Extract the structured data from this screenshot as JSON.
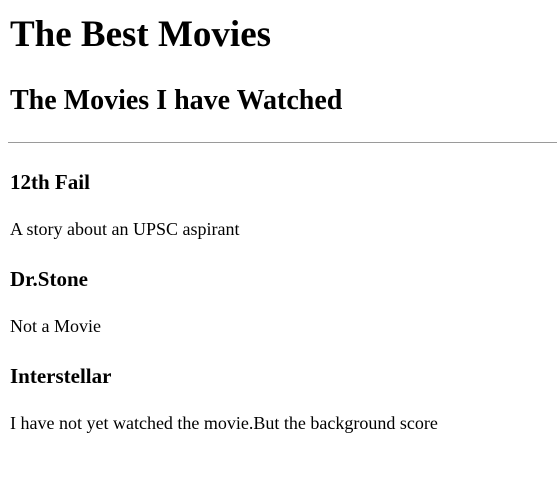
{
  "page": {
    "title": "The Best Movies",
    "subtitle": "The Movies I have Watched"
  },
  "movies": [
    {
      "title": "12th Fail",
      "description": "A story about an UPSC aspirant"
    },
    {
      "title": "Dr.Stone",
      "description": "Not a Movie"
    },
    {
      "title": "Interstellar",
      "description": "I have not yet watched the movie.But the background score"
    }
  ]
}
